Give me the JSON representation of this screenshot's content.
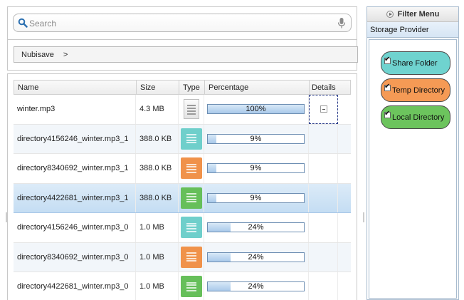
{
  "search": {
    "placeholder": "Search"
  },
  "breadcrumb": {
    "items": [
      "Nubisave",
      ">"
    ]
  },
  "table": {
    "headers": {
      "name": "Name",
      "size": "Size",
      "type": "Type",
      "percentage": "Percentage",
      "details": "Details"
    },
    "rows": [
      {
        "name": "winter.mp3",
        "size": "4.3 MB",
        "type": "document",
        "color": "",
        "percent": 100,
        "percent_label": "100%"
      },
      {
        "name": "directory4156246_winter.mp3_1",
        "size": "388.0 KB",
        "type": "share-folder",
        "color": "#6fcfcb",
        "percent": 9,
        "percent_label": "9%"
      },
      {
        "name": "directory8340692_winter.mp3_1",
        "size": "388.0 KB",
        "type": "temp-directory",
        "color": "#f0924a",
        "percent": 9,
        "percent_label": "9%"
      },
      {
        "name": "directory4422681_winter.mp3_1",
        "size": "388.0 KB",
        "type": "local-directory",
        "color": "#66bf5a",
        "percent": 9,
        "percent_label": "9%"
      },
      {
        "name": "directory4156246_winter.mp3_0",
        "size": "1.0 MB",
        "type": "share-folder",
        "color": "#6fcfcb",
        "percent": 24,
        "percent_label": "24%"
      },
      {
        "name": "directory8340692_winter.mp3_0",
        "size": "1.0 MB",
        "type": "temp-directory",
        "color": "#f0924a",
        "percent": 24,
        "percent_label": "24%"
      },
      {
        "name": "directory4422681_winter.mp3_0",
        "size": "1.0 MB",
        "type": "local-directory",
        "color": "#66bf5a",
        "percent": 24,
        "percent_label": "24%"
      }
    ]
  },
  "side": {
    "title": "Filter Menu",
    "subtitle": "Storage Provider",
    "filters": [
      {
        "label": "Share Folder",
        "checked": true,
        "color": "#6fd3cf"
      },
      {
        "label": "Temp Directory",
        "checked": true,
        "color": "#f59a55"
      },
      {
        "label": "Local Directory",
        "checked": true,
        "color": "#6cc45d"
      }
    ]
  }
}
